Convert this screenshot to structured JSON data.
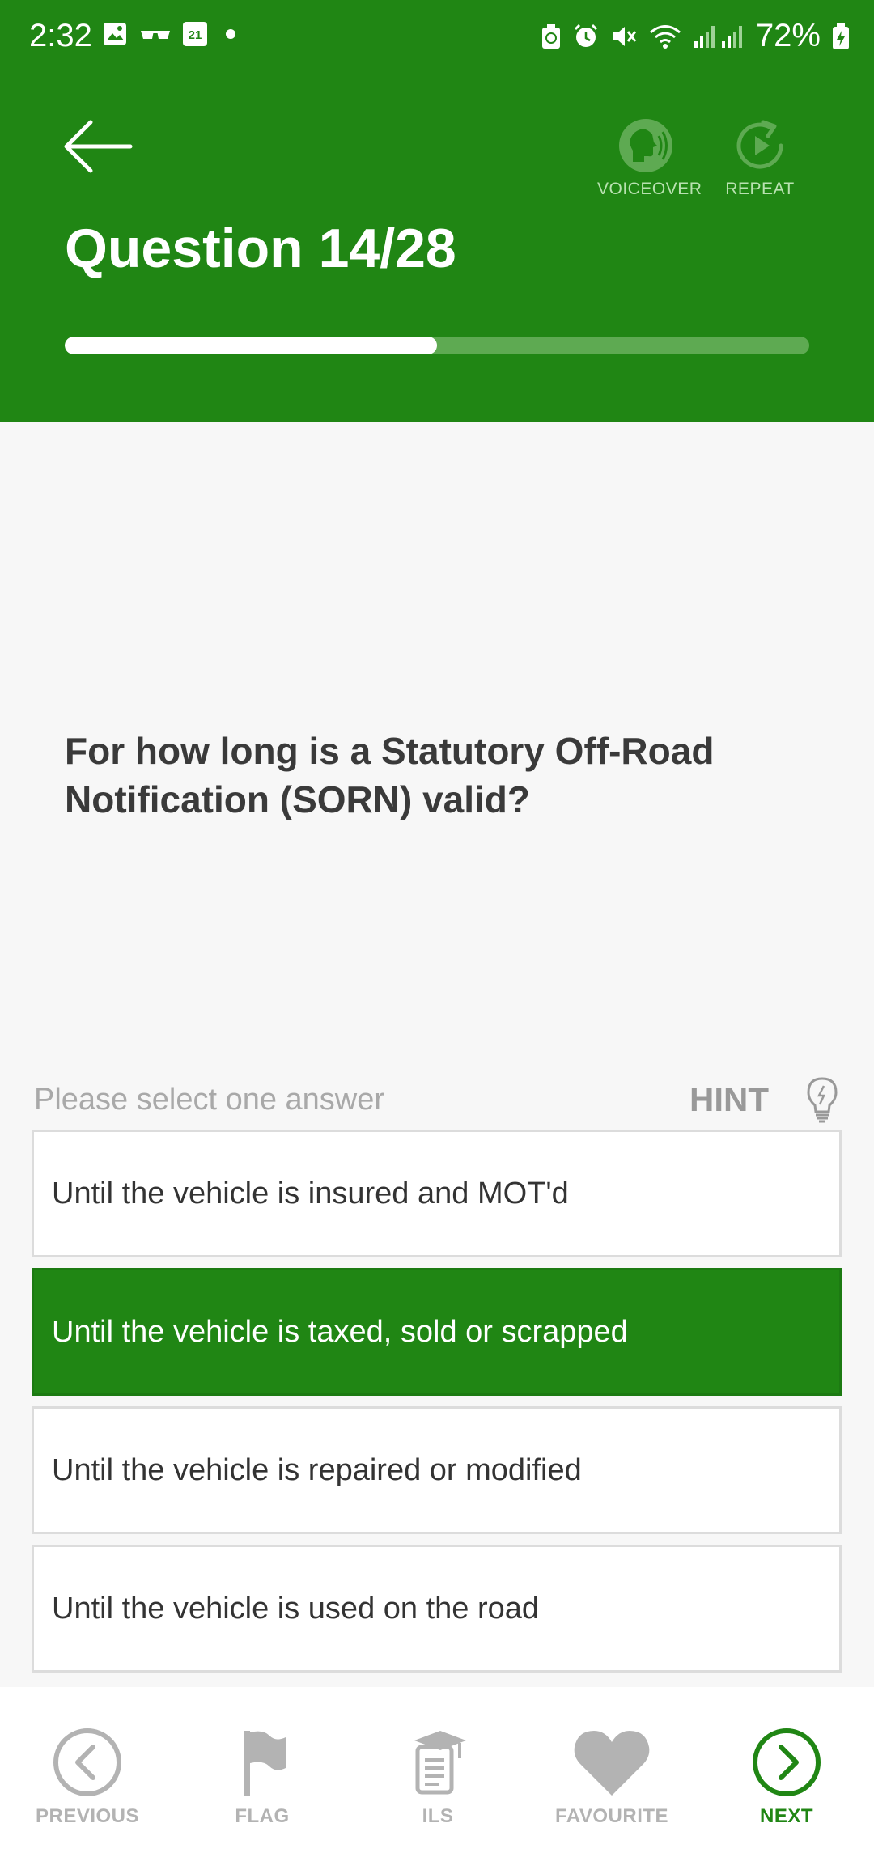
{
  "status_bar": {
    "time": "2:32",
    "calendar_day": "21",
    "battery": "72%"
  },
  "header": {
    "title": "Question 14/28",
    "voiceover_label": "VOICEOVER",
    "repeat_label": "REPEAT",
    "progress": {
      "current": 14,
      "total": 28
    }
  },
  "question": {
    "text": "For how long is a Statutory Off-Road Notification (SORN) valid?"
  },
  "answers_section": {
    "prompt": "Please select one answer",
    "hint_label": "HINT",
    "options": [
      {
        "label": "Until the vehicle is insured and MOT'd",
        "selected": false
      },
      {
        "label": "Until the vehicle is taxed, sold or scrapped",
        "selected": true
      },
      {
        "label": "Until the vehicle is repaired or modified",
        "selected": false
      },
      {
        "label": "Until the vehicle is used on the road",
        "selected": false
      }
    ]
  },
  "bottom_nav": {
    "previous": "PREVIOUS",
    "flag": "FLAG",
    "ils": "ILS",
    "favourite": "FAVOURITE",
    "next": "NEXT"
  },
  "colors": {
    "brand_green": "#208614",
    "inactive_grey": "#b3b3b3"
  },
  "icons": [
    "photo-icon",
    "glasses-icon",
    "calendar-icon",
    "dot-icon",
    "battery-saver-icon",
    "alarm-icon",
    "mute-icon",
    "wifi-icon",
    "signal-icon",
    "battery-icon",
    "back-arrow-icon",
    "voiceover-icon",
    "repeat-icon",
    "lightbulb-icon",
    "previous-icon",
    "flag-icon",
    "ils-icon",
    "heart-icon",
    "next-icon"
  ]
}
